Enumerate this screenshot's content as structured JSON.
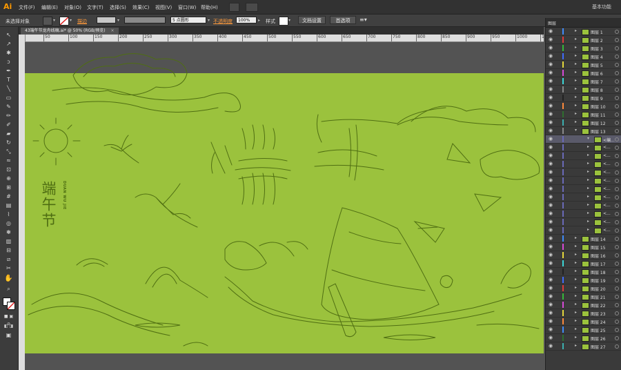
{
  "app": {
    "logo": "Ai"
  },
  "menu": [
    "文件(F)",
    "编辑(E)",
    "对象(O)",
    "文字(T)",
    "选择(S)",
    "效果(C)",
    "视图(V)",
    "窗口(W)",
    "帮助(H)"
  ],
  "workspace": "基本功能",
  "options": {
    "selection": "未选择对象",
    "stroke_label": "描边",
    "brush": "5 点圆形",
    "opacity_label": "不透明度",
    "opacity": "100%",
    "style_label": "样式",
    "doc_setup": "文档设置",
    "prefs": "首选项"
  },
  "doc_tab": "43端午节龙舟线稿.ai* @ 50% (RGB/预览)",
  "ruler_ticks": [
    "50",
    "100",
    "150",
    "200",
    "250",
    "300",
    "350",
    "400",
    "450",
    "500",
    "550",
    "600",
    "650",
    "700",
    "750",
    "800",
    "850",
    "900",
    "950",
    "1000",
    "1050"
  ],
  "artwork": {
    "title_vertical": "端午节",
    "pinyin": "DUAN WU JIE",
    "bg_color": "#9bc23d",
    "line_color": "#4f6e12"
  },
  "layers_panel": {
    "title": "图层",
    "layers": [
      {
        "name": "图层 1",
        "color": "#3f8cff",
        "open": false,
        "selected": false
      },
      {
        "name": "图层 2",
        "color": "#e03b3b",
        "open": false,
        "selected": false
      },
      {
        "name": "图层 3",
        "color": "#36b93a",
        "open": false,
        "selected": false
      },
      {
        "name": "图层 4",
        "color": "#3f6cff",
        "open": false,
        "selected": false
      },
      {
        "name": "图层 5",
        "color": "#e5d83b",
        "open": false,
        "selected": false
      },
      {
        "name": "图层 6",
        "color": "#d84ad8",
        "open": false,
        "selected": false
      },
      {
        "name": "图层 7",
        "color": "#3bd8d8",
        "open": false,
        "selected": false
      },
      {
        "name": "图层 8",
        "color": "#888888",
        "open": false,
        "selected": false
      },
      {
        "name": "图层 9",
        "color": "#222222",
        "open": false,
        "selected": false
      },
      {
        "name": "图层 10",
        "color": "#ff8a3b",
        "open": false,
        "selected": false
      },
      {
        "name": "图层 11",
        "color": "#2f6f2f",
        "open": false,
        "selected": false
      },
      {
        "name": "图层 12",
        "color": "#3bb0b0",
        "open": false,
        "selected": false
      },
      {
        "name": "图层 13",
        "color": "#8a8a8a",
        "open": true,
        "selected": false
      },
      {
        "name": "<编...",
        "color": "#6a6ab8",
        "open": true,
        "selected": true
      },
      {
        "name": "<...",
        "color": "#6a6ab8",
        "open": false,
        "selected": false
      },
      {
        "name": "<...",
        "color": "#6a6ab8",
        "open": false,
        "selected": false
      },
      {
        "name": "<...",
        "color": "#6a6ab8",
        "open": false,
        "selected": false
      },
      {
        "name": "<...",
        "color": "#6a6ab8",
        "open": false,
        "selected": false
      },
      {
        "name": "<...",
        "color": "#6a6ab8",
        "open": false,
        "selected": false
      },
      {
        "name": "<...",
        "color": "#6a6ab8",
        "open": false,
        "selected": false
      },
      {
        "name": "<...",
        "color": "#6a6ab8",
        "open": false,
        "selected": false
      },
      {
        "name": "<...",
        "color": "#6a6ab8",
        "open": false,
        "selected": false
      },
      {
        "name": "<...",
        "color": "#6a6ab8",
        "open": false,
        "selected": false
      },
      {
        "name": "<...",
        "color": "#6a6ab8",
        "open": false,
        "selected": false
      },
      {
        "name": "<...",
        "color": "#6a6ab8",
        "open": false,
        "selected": false
      },
      {
        "name": "图层 14",
        "color": "#3f8cff",
        "open": false,
        "selected": false
      },
      {
        "name": "图层 15",
        "color": "#d84ad8",
        "open": false,
        "selected": false
      },
      {
        "name": "图层 16",
        "color": "#e5d83b",
        "open": false,
        "selected": false
      },
      {
        "name": "图层 17",
        "color": "#3bd8d8",
        "open": false,
        "selected": false
      },
      {
        "name": "图层 18",
        "color": "#222222",
        "open": false,
        "selected": false
      },
      {
        "name": "图层 19",
        "color": "#3f6cff",
        "open": false,
        "selected": false
      },
      {
        "name": "图层 20",
        "color": "#e03b3b",
        "open": false,
        "selected": false
      },
      {
        "name": "图层 21",
        "color": "#36b93a",
        "open": false,
        "selected": false
      },
      {
        "name": "图层 22",
        "color": "#d84ad8",
        "open": false,
        "selected": false
      },
      {
        "name": "图层 23",
        "color": "#e5d83b",
        "open": false,
        "selected": false
      },
      {
        "name": "图层 24",
        "color": "#ff8a3b",
        "open": false,
        "selected": false
      },
      {
        "name": "图层 25",
        "color": "#3f8cff",
        "open": false,
        "selected": false
      },
      {
        "name": "图层 26",
        "color": "#2f6f2f",
        "open": false,
        "selected": false
      },
      {
        "name": "图层 27",
        "color": "#3bb0b0",
        "open": false,
        "selected": false
      }
    ]
  }
}
